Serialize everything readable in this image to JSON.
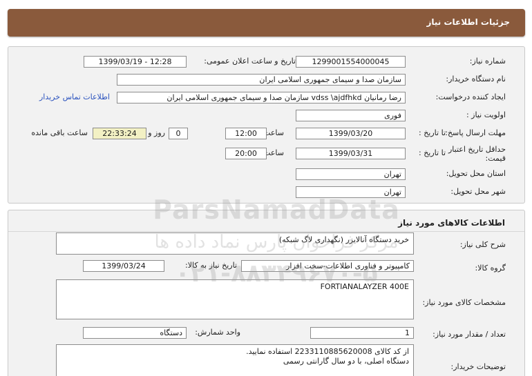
{
  "header": {
    "title": "جزئیات اطلاعات نیاز"
  },
  "need_info": {
    "need_number": {
      "label": "شماره نیاز:",
      "value": "1299001554000045"
    },
    "announce": {
      "label": "تاریخ و ساعت اعلان عمومی:",
      "value": "1399/03/19 - 12:28"
    },
    "buyer_org": {
      "label": "نام دستگاه خریدار:",
      "value": "سازمان صدا و سیمای جمهوری اسلامی ایران"
    },
    "requester": {
      "label": "ایجاد کننده درخواست:",
      "value": "رضا رمانیان vdss \\ajdfhkd سازمان صدا و سیمای جمهوری اسلامی ایران",
      "contact_link": "اطلاعات تماس خریدار"
    },
    "priority": {
      "label": "اولویت نیاز :",
      "value": "فوری"
    },
    "reply_deadline": {
      "label": "مهلت ارسال پاسخ:",
      "to_date_label": "تا تاریخ :",
      "date": "1399/03/20",
      "time_label": "ساعت",
      "time": "12:00",
      "days": "0",
      "days_label": "روز و",
      "remaining": "22:33:24",
      "remaining_label": "ساعت باقی مانده"
    },
    "price_validity": {
      "label": "حداقل تاریخ اعتبار قیمت:",
      "to_date_label": "تا تاریخ :",
      "date": "1399/03/31",
      "time_label": "ساعت",
      "time": "20:00"
    },
    "delivery_province": {
      "label": "استان محل تحویل:",
      "value": "تهران"
    },
    "delivery_city": {
      "label": "شهر محل تحویل:",
      "value": "تهران"
    }
  },
  "goods": {
    "title": "اطلاعات کالاهای مورد نیاز",
    "summary": {
      "label": "شرح کلی نیاز:",
      "value": "خرید دستگاه آنالایزر (نگهداری لاگ شبکه)"
    },
    "group": {
      "label": "گروه کالا:",
      "value": "کامپیوتر و فناوری اطلاعات-سخت افزار",
      "need_date_label": "تاریخ نیاز به کالا:",
      "need_date": "1399/03/24"
    },
    "specs": {
      "label": "مشخصات کالای مورد نیاز:",
      "value": "FORTIANALAYZER 400E"
    },
    "quantity": {
      "label": "تعداد / مقدار مورد نیاز:",
      "value": "1",
      "unit_label": "واحد شمارش:",
      "unit": "دستگاه"
    },
    "buyer_notes": {
      "label": "توضیحات خریدار:",
      "line1": "از کد کالای 2233110885620008 استفاده نمایید.",
      "line2": "دستگاه اصلی، با دو سال گارانتی رسمی"
    }
  },
  "watermark": {
    "brand": "ParsNamadData",
    "tagline": "مرکز فراخوان پارس نماد داده ها",
    "phone": "۰۲۱-۸۸۳۴۹۶۷۰-۵"
  }
}
